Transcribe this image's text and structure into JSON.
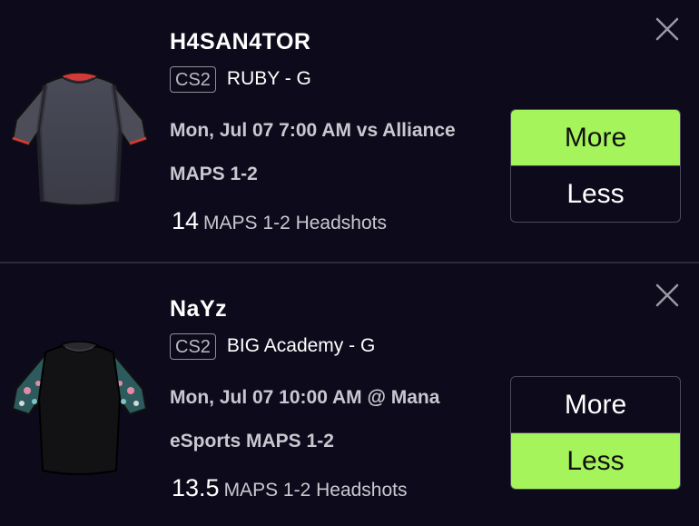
{
  "colors": {
    "background": "#0d0b1b",
    "selected": "#a6f45b",
    "divider": "#2c2b3b"
  },
  "cards": [
    {
      "player_name": "H4SAN4TOR",
      "game_badge": "CS2",
      "team": "RUBY - G",
      "match_line1": "Mon, Jul 07 7:00 AM vs Alliance",
      "match_line2": "MAPS 1-2",
      "stat_value": "14",
      "stat_label": "MAPS 1-2 Headshots",
      "more_label": "More",
      "less_label": "Less",
      "selected": "More",
      "jersey_icon": "dark-grey-jersey-icon",
      "close_icon": "close-icon"
    },
    {
      "player_name": "NaYz",
      "game_badge": "CS2",
      "team": "BIG Academy - G",
      "match_line1": "Mon, Jul 07 10:00 AM @ Mana",
      "match_line2": "eSports MAPS 1-2",
      "stat_value": "13.5",
      "stat_label": "MAPS 1-2 Headshots",
      "more_label": "More",
      "less_label": "Less",
      "selected": "Less",
      "jersey_icon": "black-floral-jersey-icon",
      "close_icon": "close-icon"
    }
  ]
}
